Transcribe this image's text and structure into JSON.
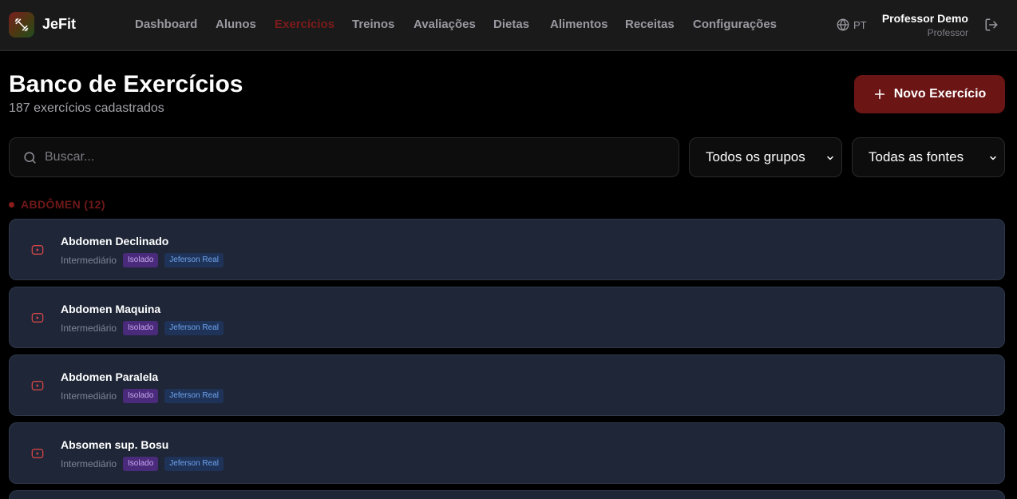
{
  "header": {
    "brand": "JeFit",
    "nav": [
      {
        "label": "Dashboard",
        "active": false
      },
      {
        "label": "Alunos",
        "active": false
      },
      {
        "label": "Exercícios",
        "active": true
      },
      {
        "label": "Treinos",
        "active": false
      },
      {
        "label": "Avaliações",
        "active": false
      },
      {
        "label": "Dietas",
        "active": false
      },
      {
        "label": "Alimentos",
        "active": false
      },
      {
        "label": "Receitas",
        "active": false
      },
      {
        "label": "Configurações",
        "active": false
      }
    ],
    "language": "PT",
    "user_name": "Professor Demo",
    "user_role": "Professor"
  },
  "page": {
    "title": "Banco de Exercícios",
    "subtitle": "187 exercícios cadastrados",
    "new_button": "Novo Exercício"
  },
  "filters": {
    "search_placeholder": "Buscar...",
    "group_select": "Todos os grupos",
    "source_select": "Todas as fontes"
  },
  "groups": [
    {
      "label": "ABDÔMEN (12)",
      "exercises": [
        {
          "name": "Abdomen Declinado",
          "level": "Intermediário",
          "type": "Isolado",
          "source": "Jeferson Real"
        },
        {
          "name": "Abdomen Maquina",
          "level": "Intermediário",
          "type": "Isolado",
          "source": "Jeferson Real"
        },
        {
          "name": "Abdomen Paralela",
          "level": "Intermediário",
          "type": "Isolado",
          "source": "Jeferson Real"
        },
        {
          "name": "Absomen sup. Bosu",
          "level": "Intermediário",
          "type": "Isolado",
          "source": "Jeferson Real"
        }
      ]
    }
  ],
  "colors": {
    "accent": "#6b1515",
    "active_nav": "#7d1a1a",
    "card_bg": "#1e2637",
    "tag_isolado": "#4a2a7a",
    "tag_source": "#1f3358"
  },
  "icons": {
    "logo": "dumbbell-icon",
    "language": "globe-icon",
    "logout": "logout-icon",
    "search": "search-icon",
    "add": "plus-icon",
    "exercise_video": "video-icon",
    "select": "chevron-down-icon"
  }
}
